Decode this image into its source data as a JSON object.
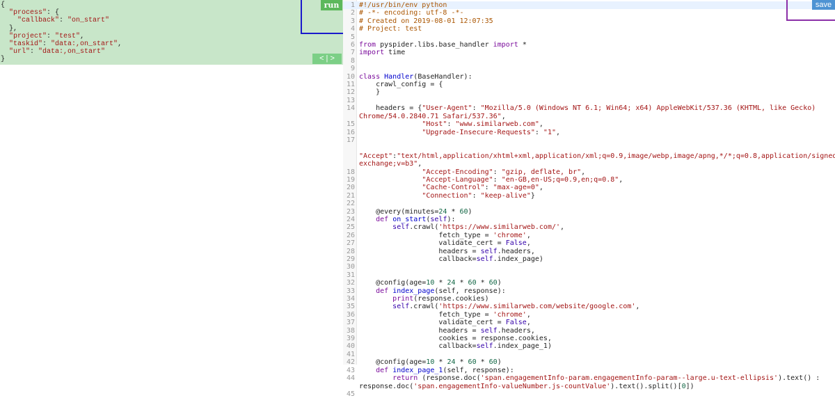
{
  "task_panel": {
    "run_label": "run",
    "pager_label": "< | >",
    "json_lines": [
      [
        [
          "p",
          "{"
        ]
      ],
      [
        [
          "p",
          "  "
        ],
        [
          "k",
          "\"process\""
        ],
        [
          "p",
          ": {"
        ]
      ],
      [
        [
          "p",
          "    "
        ],
        [
          "k",
          "\"callback\""
        ],
        [
          "p",
          ": "
        ],
        [
          "s",
          "\"on_start\""
        ]
      ],
      [
        [
          "p",
          "  },"
        ]
      ],
      [
        [
          "p",
          "  "
        ],
        [
          "k",
          "\"project\""
        ],
        [
          "p",
          ": "
        ],
        [
          "s",
          "\"test\""
        ],
        [
          "p",
          ","
        ]
      ],
      [
        [
          "p",
          "  "
        ],
        [
          "k",
          "\"taskid\""
        ],
        [
          "p",
          ": "
        ],
        [
          "s",
          "\"data:,on_start\""
        ],
        [
          "p",
          ","
        ]
      ],
      [
        [
          "p",
          "  "
        ],
        [
          "k",
          "\"url\""
        ],
        [
          "p",
          ": "
        ],
        [
          "s",
          "\"data:,on_start\""
        ]
      ],
      [
        [
          "p",
          "}"
        ]
      ]
    ]
  },
  "editor": {
    "save_label": "save",
    "lines": [
      {
        "n": "1",
        "active": true,
        "cls": "comment",
        "t": "#!/usr/bin/env python"
      },
      {
        "n": "2",
        "cls": "comment",
        "t": "# -*- encoding: utf-8 -*-"
      },
      {
        "n": "3",
        "cls": "comment",
        "t": "# Created on 2019-08-01 12:07:35"
      },
      {
        "n": "4",
        "cls": "comment",
        "t": "# Project: test"
      },
      {
        "n": "5",
        "t": ""
      },
      {
        "n": "6",
        "h": "<span class='kw'>from</span> pyspider.libs.base_handler <span class='kw'>import</span> *"
      },
      {
        "n": "7",
        "h": "<span class='kw'>import</span> time"
      },
      {
        "n": "8",
        "t": ""
      },
      {
        "n": "9",
        "t": ""
      },
      {
        "n": "10",
        "h": "<span class='kw'>class</span> <span class='fn'>Handler</span>(BaseHandler):"
      },
      {
        "n": "11",
        "t": "    crawl_config = {"
      },
      {
        "n": "12",
        "t": "    }"
      },
      {
        "n": "13",
        "t": ""
      },
      {
        "n": "14",
        "h": "    headers = {<span class='st'>\"User-Agent\"</span>: <span class='st'>\"Mozilla/5.0 (Windows NT 6.1; Win64; x64) AppleWebKit/537.36 (KHTML, like Gecko)</span>",
        "cont": "<span class='st'>Chrome/54.0.2840.71 Safari/537.36\"</span>,"
      },
      {
        "n": "15",
        "h": "               <span class='st'>\"Host\"</span>: <span class='st'>\"www.similarweb.com\"</span>,"
      },
      {
        "n": "16",
        "h": "               <span class='st'>\"Upgrade-Insecure-Requests\"</span>: <span class='st'>\"1\"</span>,"
      },
      {
        "n": "17",
        "t": "",
        "cont": " ",
        "cont2": "<span class='st'>\"Accept\"</span>:<span class='st'>\"text/html,application/xhtml+xml,application/xml;q=0.9,image/webp,image/apng,*/*;q=0.8,application/signed-</span>",
        "cont3": "<span class='st'>exchange;v=b3\"</span>,"
      },
      {
        "n": "18",
        "h": "               <span class='st'>\"Accept-Encoding\"</span>: <span class='st'>\"gzip, deflate, br\"</span>,"
      },
      {
        "n": "19",
        "h": "               <span class='st'>\"Accept-Language\"</span>: <span class='st'>\"en-GB,en-US;q=0.9,en;q=0.8\"</span>,"
      },
      {
        "n": "20",
        "h": "               <span class='st'>\"Cache-Control\"</span>: <span class='st'>\"max-age=0\"</span>,"
      },
      {
        "n": "21",
        "h": "               <span class='st'>\"Connection\"</span>: <span class='st'>\"keep-alive\"</span>}"
      },
      {
        "n": "22",
        "t": ""
      },
      {
        "n": "23",
        "h": "    @every(minutes=<span class='nb'>24</span> * <span class='nb'>60</span>)"
      },
      {
        "n": "24",
        "h": "    <span class='kw'>def</span> <span class='fn'>on_start</span>(<span class='bi'>self</span>):"
      },
      {
        "n": "25",
        "h": "        <span class='bi'>self</span>.crawl(<span class='st'>'https://www.similarweb.com/'</span>,"
      },
      {
        "n": "26",
        "h": "                   fetch_type = <span class='st'>'chrome'</span>,"
      },
      {
        "n": "27",
        "h": "                   validate_cert = <span class='bi'>False</span>,"
      },
      {
        "n": "28",
        "h": "                   headers = <span class='bi'>self</span>.headers,"
      },
      {
        "n": "29",
        "h": "                   callback=<span class='bi'>self</span>.index_page)"
      },
      {
        "n": "30",
        "t": ""
      },
      {
        "n": "31",
        "t": ""
      },
      {
        "n": "32",
        "h": "    @config(age=<span class='nb'>10</span> * <span class='nb'>24</span> * <span class='nb'>60</span> * <span class='nb'>60</span>)"
      },
      {
        "n": "33",
        "h": "    <span class='kw'>def</span> <span class='fn'>index_page</span>(self, response):"
      },
      {
        "n": "34",
        "h": "        <span class='kw'>print</span>(response.cookies)"
      },
      {
        "n": "35",
        "h": "        <span class='bi'>self</span>.crawl(<span class='st'>'https://www.similarweb.com/website/google.com'</span>,"
      },
      {
        "n": "36",
        "h": "                   fetch_type = <span class='st'>'chrome'</span>,"
      },
      {
        "n": "37",
        "h": "                   validate_cert = <span class='bi'>False</span>,"
      },
      {
        "n": "38",
        "h": "                   headers = <span class='bi'>self</span>.headers,"
      },
      {
        "n": "39",
        "h": "                   cookies = response.cookies,"
      },
      {
        "n": "40",
        "h": "                   callback=<span class='bi'>self</span>.index_page_1)"
      },
      {
        "n": "41",
        "t": ""
      },
      {
        "n": "42",
        "h": "    @config(age=<span class='nb'>10</span> * <span class='nb'>24</span> * <span class='nb'>60</span> * <span class='nb'>60</span>)"
      },
      {
        "n": "43",
        "h": "    <span class='kw'>def</span> <span class='fn'>index_page_1</span>(self, response):"
      },
      {
        "n": "44",
        "h": "        <span class='kw'>return</span> (response.doc(<span class='st'>'span.engagementInfo-param.engagementInfo-param--large.u-text-ellipsis'</span>).text() :",
        "cont": "response.doc(<span class='st'>'span.engagementInfo-valueNumber.js-countValue'</span>).text().split()[<span class='nb'>0</span>])"
      },
      {
        "n": "45",
        "t": ""
      }
    ]
  }
}
